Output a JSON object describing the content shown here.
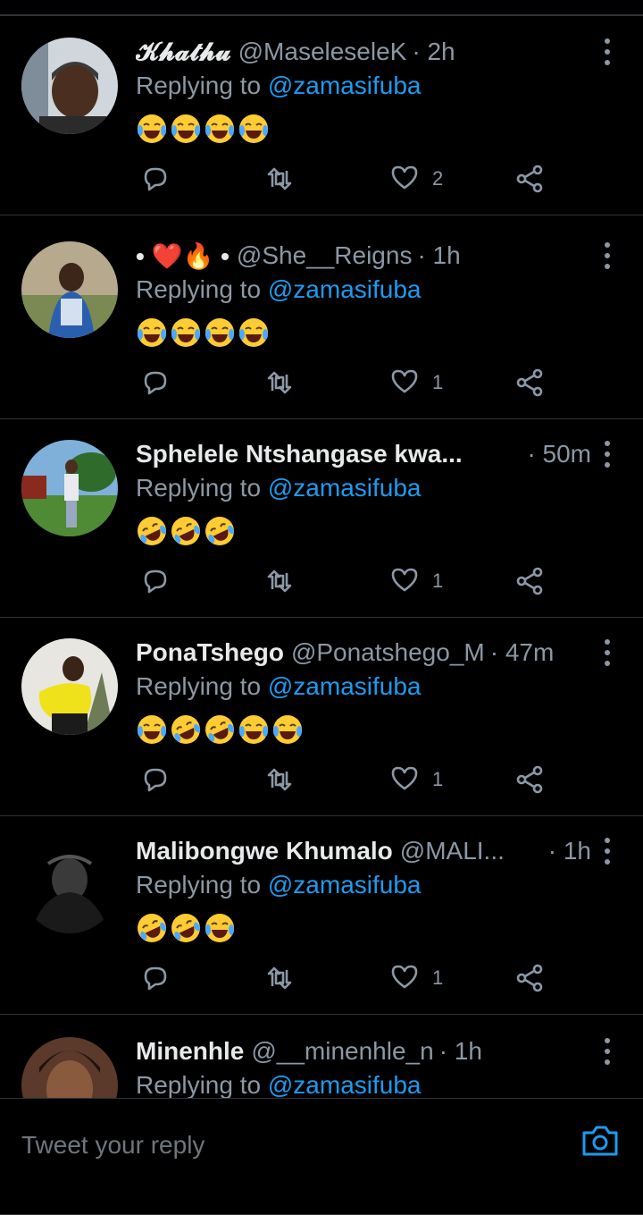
{
  "replying_label": "Replying to",
  "replies": [
    {
      "name": "𝓚𝓱𝓪𝓽𝓱𝓾",
      "handle": "@MaseleseleK",
      "time": "· 2h",
      "replying_to": "@zamasifuba",
      "emoji_text": "😂😂😂😂",
      "emojis": [
        "joy",
        "joy",
        "joy",
        "joy"
      ],
      "likes": "2"
    },
    {
      "name": "• ❤️🔥 •",
      "handle": "@She__Reigns",
      "time": "· 1h",
      "replying_to": "@zamasifuba",
      "emoji_text": "😂😂😂😂",
      "emojis": [
        "joy",
        "joy",
        "joy",
        "joy"
      ],
      "likes": "1"
    },
    {
      "name": "Sphelele Ntshangase kwa...",
      "handle": "",
      "time": "· 50m",
      "replying_to": "@zamasifuba",
      "emoji_text": "🤣🤣🤣",
      "emojis": [
        "rofl",
        "rofl",
        "rofl"
      ],
      "likes": "1"
    },
    {
      "name": "PonaTshego",
      "handle": "@Ponatshego_M",
      "time": "· 47m",
      "replying_to": "@zamasifuba",
      "emoji_text": "😂🤣🤣😂😂",
      "emojis": [
        "joy",
        "rofl",
        "rofl",
        "joy",
        "joy"
      ],
      "likes": "1"
    },
    {
      "name": "Malibongwe Khumalo",
      "handle": "@MALI...",
      "time": "· 1h",
      "replying_to": "@zamasifuba",
      "emoji_text": "🤣🤣😂",
      "emojis": [
        "rofl",
        "rofl",
        "joy"
      ],
      "likes": "1"
    },
    {
      "name": "Minenhle",
      "handle": "@__minenhle_n",
      "time": "· 1h",
      "replying_to": "@zamasifuba",
      "emoji_text": "",
      "emojis": [],
      "likes": ""
    }
  ],
  "compose": {
    "placeholder": "Tweet your reply"
  },
  "colors": {
    "background": "#000000",
    "text": "#e7e9ea",
    "secondary": "#8b98a5",
    "link": "#1d9bf0",
    "divider": "#2f3336"
  },
  "icons": [
    "more-icon",
    "reply-icon",
    "retweet-icon",
    "like-icon",
    "share-icon",
    "camera-icon"
  ]
}
